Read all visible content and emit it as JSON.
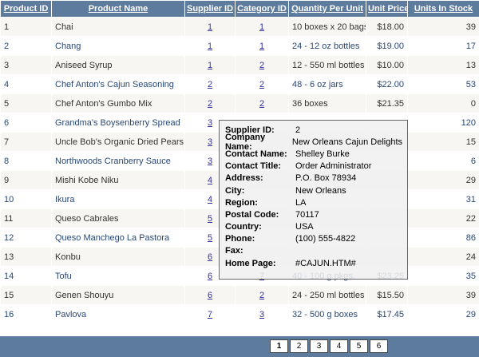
{
  "headers": [
    "Product ID",
    "Product Name",
    "Supplier ID",
    "Category ID",
    "Quantity Per Unit",
    "Unit Price",
    "Units In Stock"
  ],
  "rows": [
    {
      "id": "1",
      "name": "Chai",
      "supplier": "1",
      "category": "1",
      "qty": "10 boxes x 20 bags",
      "price": "$18.00",
      "stock": "39"
    },
    {
      "id": "2",
      "name": "Chang",
      "supplier": "1",
      "category": "1",
      "qty": "24 - 12 oz bottles",
      "price": "$19.00",
      "stock": "17"
    },
    {
      "id": "3",
      "name": "Aniseed Syrup",
      "supplier": "1",
      "category": "2",
      "qty": "12 - 550 ml bottles",
      "price": "$10.00",
      "stock": "13"
    },
    {
      "id": "4",
      "name": "Chef Anton's Cajun Seasoning",
      "supplier": "2",
      "category": "2",
      "qty": "48 - 6 oz jars",
      "price": "$22.00",
      "stock": "53"
    },
    {
      "id": "5",
      "name": "Chef Anton's Gumbo Mix",
      "supplier": "2",
      "category": "2",
      "qty": "36 boxes",
      "price": "$21.35",
      "stock": "0"
    },
    {
      "id": "6",
      "name": "Grandma's Boysenberry Spread",
      "supplier": "3",
      "category": "",
      "qty": "",
      "price": "",
      "stock": "120"
    },
    {
      "id": "7",
      "name": "Uncle Bob's Organic Dried Pears",
      "supplier": "3",
      "category": "",
      "qty": "",
      "price": "",
      "stock": "15"
    },
    {
      "id": "8",
      "name": "Northwoods Cranberry Sauce",
      "supplier": "3",
      "category": "",
      "qty": "",
      "price": "",
      "stock": "6"
    },
    {
      "id": "9",
      "name": "Mishi Kobe Niku",
      "supplier": "4",
      "category": "",
      "qty": "",
      "price": "",
      "stock": "29"
    },
    {
      "id": "10",
      "name": "Ikura",
      "supplier": "4",
      "category": "",
      "qty": "",
      "price": "",
      "stock": "31"
    },
    {
      "id": "11",
      "name": "Queso Cabrales",
      "supplier": "5",
      "category": "",
      "qty": "",
      "price": "",
      "stock": "22"
    },
    {
      "id": "12",
      "name": "Queso Manchego La Pastora",
      "supplier": "5",
      "category": "",
      "qty": "",
      "price": "",
      "stock": "86"
    },
    {
      "id": "13",
      "name": "Konbu",
      "supplier": "6",
      "category": "",
      "qty": "",
      "price": "",
      "stock": "24"
    },
    {
      "id": "14",
      "name": "Tofu",
      "supplier": "6",
      "category": "7",
      "qty": "40 - 100 g pkgs.",
      "price": "$23.25",
      "stock": "35"
    },
    {
      "id": "15",
      "name": "Genen Shouyu",
      "supplier": "6",
      "category": "2",
      "qty": "24 - 250 ml bottles",
      "price": "$15.50",
      "stock": "39"
    },
    {
      "id": "16",
      "name": "Pavlova",
      "supplier": "7",
      "category": "3",
      "qty": "32 - 500 g boxes",
      "price": "$17.45",
      "stock": "29"
    }
  ],
  "pager": {
    "pages": [
      "1",
      "2",
      "3",
      "4",
      "5",
      "6"
    ],
    "current": "1"
  },
  "tooltip": [
    {
      "label": "Supplier ID:",
      "value": "2"
    },
    {
      "label": "Company Name:",
      "value": "New Orleans Cajun Delights"
    },
    {
      "label": "Contact Name:",
      "value": "Shelley Burke"
    },
    {
      "label": "Contact Title:",
      "value": "Order Administrator"
    },
    {
      "label": "Address:",
      "value": "P.O. Box 78934"
    },
    {
      "label": "City:",
      "value": "New Orleans"
    },
    {
      "label": "Region:",
      "value": "LA"
    },
    {
      "label": "Postal Code:",
      "value": "70117"
    },
    {
      "label": "Country:",
      "value": "USA"
    },
    {
      "label": "Phone:",
      "value": "(100) 555-4822"
    },
    {
      "label": "Fax:",
      "value": ""
    },
    {
      "label": "Home Page:",
      "value": "#CAJUN.HTM#"
    }
  ],
  "colors": {
    "header_bg": "#5d7b9d",
    "odd_row": "#f7f6f3",
    "even_row": "#ffffff",
    "link": "#333399"
  }
}
